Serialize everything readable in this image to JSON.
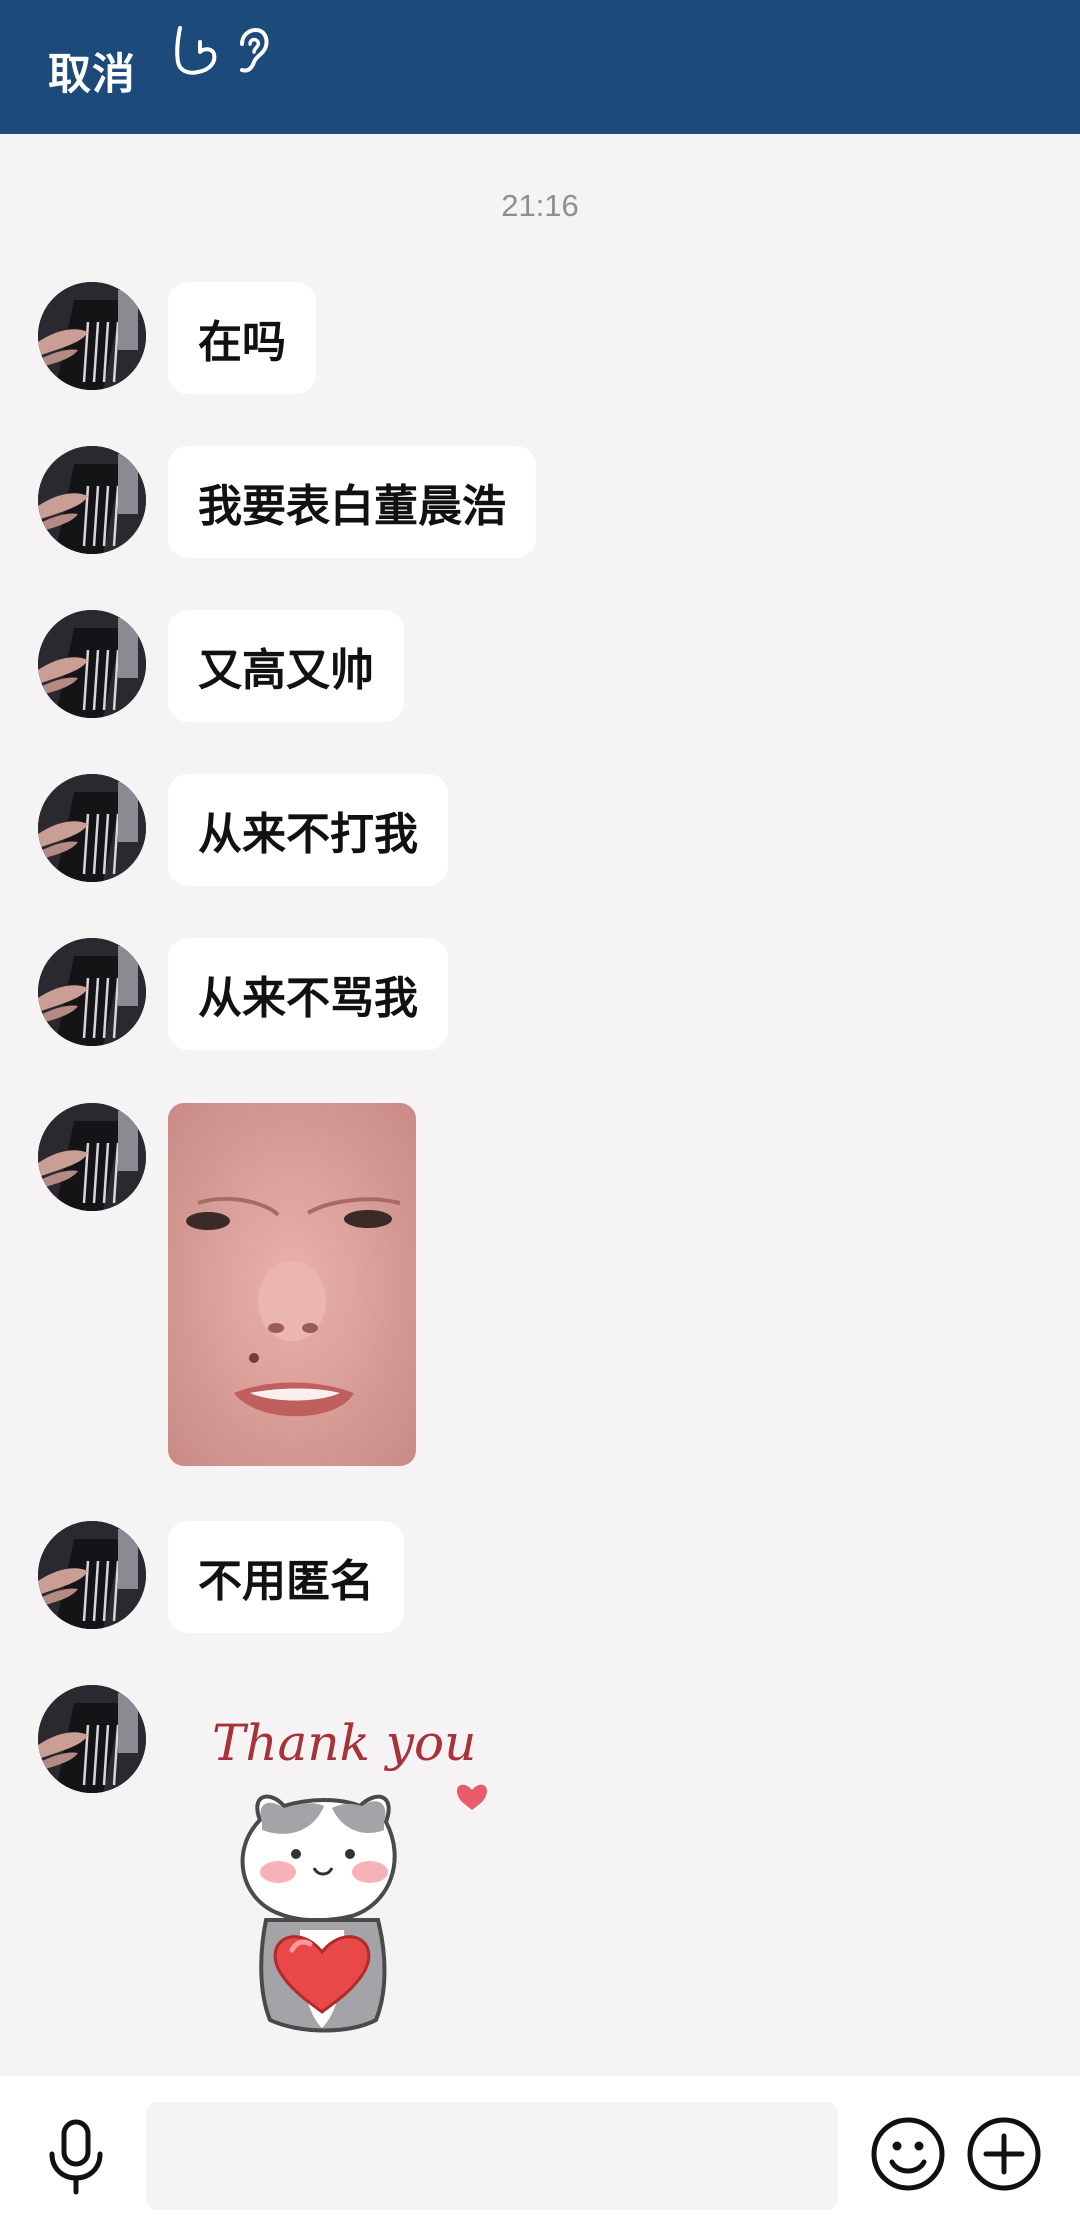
{
  "header": {
    "cancel_label": "取消",
    "icons": [
      "hand-icon",
      "ear-icon"
    ],
    "background": "#1c4a7b"
  },
  "chat": {
    "timestamp": "21:16",
    "messages": [
      {
        "type": "text",
        "text": "在吗"
      },
      {
        "type": "text",
        "text": "我要表白董晨浩"
      },
      {
        "type": "text",
        "text": "又高又帅"
      },
      {
        "type": "text",
        "text": "从来不打我"
      },
      {
        "type": "text",
        "text": "从来不骂我"
      },
      {
        "type": "image",
        "content": "photo"
      },
      {
        "type": "text",
        "text": "不用匿名"
      },
      {
        "type": "sticker",
        "content": "sticker",
        "sticker_text": "Thank you"
      }
    ]
  },
  "composer": {
    "input_value": "",
    "icons": [
      "microphone-icon",
      "emoji-icon",
      "plus-icon"
    ]
  }
}
